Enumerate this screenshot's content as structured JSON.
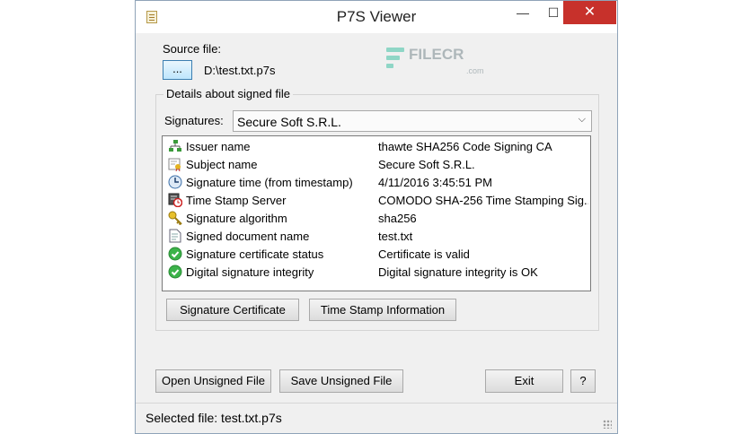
{
  "window": {
    "title": "P7S Viewer",
    "min_glyph": "—",
    "max_glyph": "☐",
    "close_glyph": "✕"
  },
  "source": {
    "label": "Source file:",
    "browse_label": "...",
    "path": "D:\\test.txt.p7s"
  },
  "watermark": {
    "brand": "FILECR",
    "sub": ".com"
  },
  "details": {
    "group_label": "Details about signed file",
    "signatures_label": "Signatures:",
    "selected_signature": "Secure Soft S.R.L.",
    "rows": [
      {
        "icon": "issuer-tree-icon",
        "name": "Issuer name",
        "value": "thawte SHA256 Code Signing CA"
      },
      {
        "icon": "subject-certificate-icon",
        "name": "Subject name",
        "value": "Secure Soft S.R.L."
      },
      {
        "icon": "clock-icon",
        "name": "Signature time (from timestamp)",
        "value": "4/11/2016 3:45:51 PM"
      },
      {
        "icon": "timestamp-server-icon",
        "name": "Time Stamp Server",
        "value": "COMODO SHA-256 Time Stamping Sig..."
      },
      {
        "icon": "key-icon",
        "name": "Signature algorithm",
        "value": "sha256"
      },
      {
        "icon": "document-icon",
        "name": "Signed document name",
        "value": "test.txt"
      },
      {
        "icon": "check-circle-icon",
        "name": "Signature certificate status",
        "value": "Certificate is valid"
      },
      {
        "icon": "check-circle-icon",
        "name": "Digital signature integrity",
        "value": "Digital signature integrity is OK"
      }
    ],
    "signature_certificate_button": "Signature Certificate",
    "time_stamp_button": "Time Stamp Information"
  },
  "actions": {
    "open_unsigned": "Open Unsigned File",
    "save_unsigned": "Save Unsigned File",
    "exit": "Exit",
    "help": "?"
  },
  "status": {
    "text": "Selected file: test.txt.p7s"
  }
}
